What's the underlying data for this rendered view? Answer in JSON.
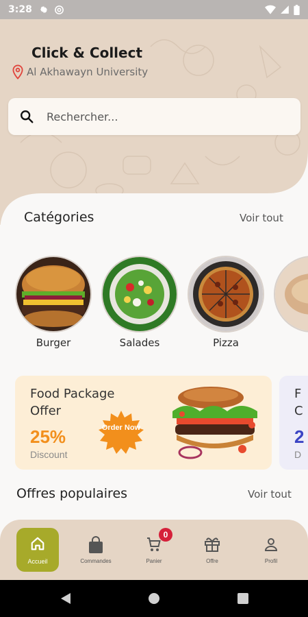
{
  "status_bar": {
    "time": "3:28",
    "icons": [
      "gear-icon",
      "at-icon",
      "wifi-icon",
      "signal-icon",
      "battery-icon"
    ]
  },
  "header": {
    "title": "Click & Collect",
    "location": "Al Akhawayn University",
    "location_icon": "map-pin-icon",
    "search_placeholder": "Rechercher..."
  },
  "categories": {
    "title": "Catégories",
    "see_all": "Voir tout",
    "items": [
      {
        "label": "Burger",
        "icon": "burger"
      },
      {
        "label": "Salades",
        "icon": "salad"
      },
      {
        "label": "Pizza",
        "icon": "pizza"
      },
      {
        "label": "",
        "icon": "bread"
      }
    ]
  },
  "promos": [
    {
      "title": "Food Package Offer",
      "percent": "25%",
      "discount": "Discount",
      "badge": "Order Now",
      "accent": "#f28f1c",
      "background": "#fdeed6"
    },
    {
      "title": "F C",
      "percent": "2",
      "discount": "D",
      "accent": "#3b44c4",
      "background": "#eeedf8"
    }
  ],
  "popular": {
    "title": "Offres populaires",
    "see_all": "Voir tout"
  },
  "bottom_nav": {
    "items": [
      {
        "label": "Accueil",
        "icon": "home-icon",
        "active": true
      },
      {
        "label": "Commandes",
        "icon": "shopping-bag-icon",
        "active": false
      },
      {
        "label": "Panier",
        "icon": "cart-icon",
        "active": false,
        "badge": "0"
      },
      {
        "label": "Offre",
        "icon": "gift-icon",
        "active": false
      },
      {
        "label": "Profil",
        "icon": "person-icon",
        "active": false
      }
    ]
  },
  "colors": {
    "header_bg": "#e5d5c5",
    "active_nav": "#a7aa2a",
    "badge": "#d5203a",
    "location_pin": "#e0443c"
  }
}
